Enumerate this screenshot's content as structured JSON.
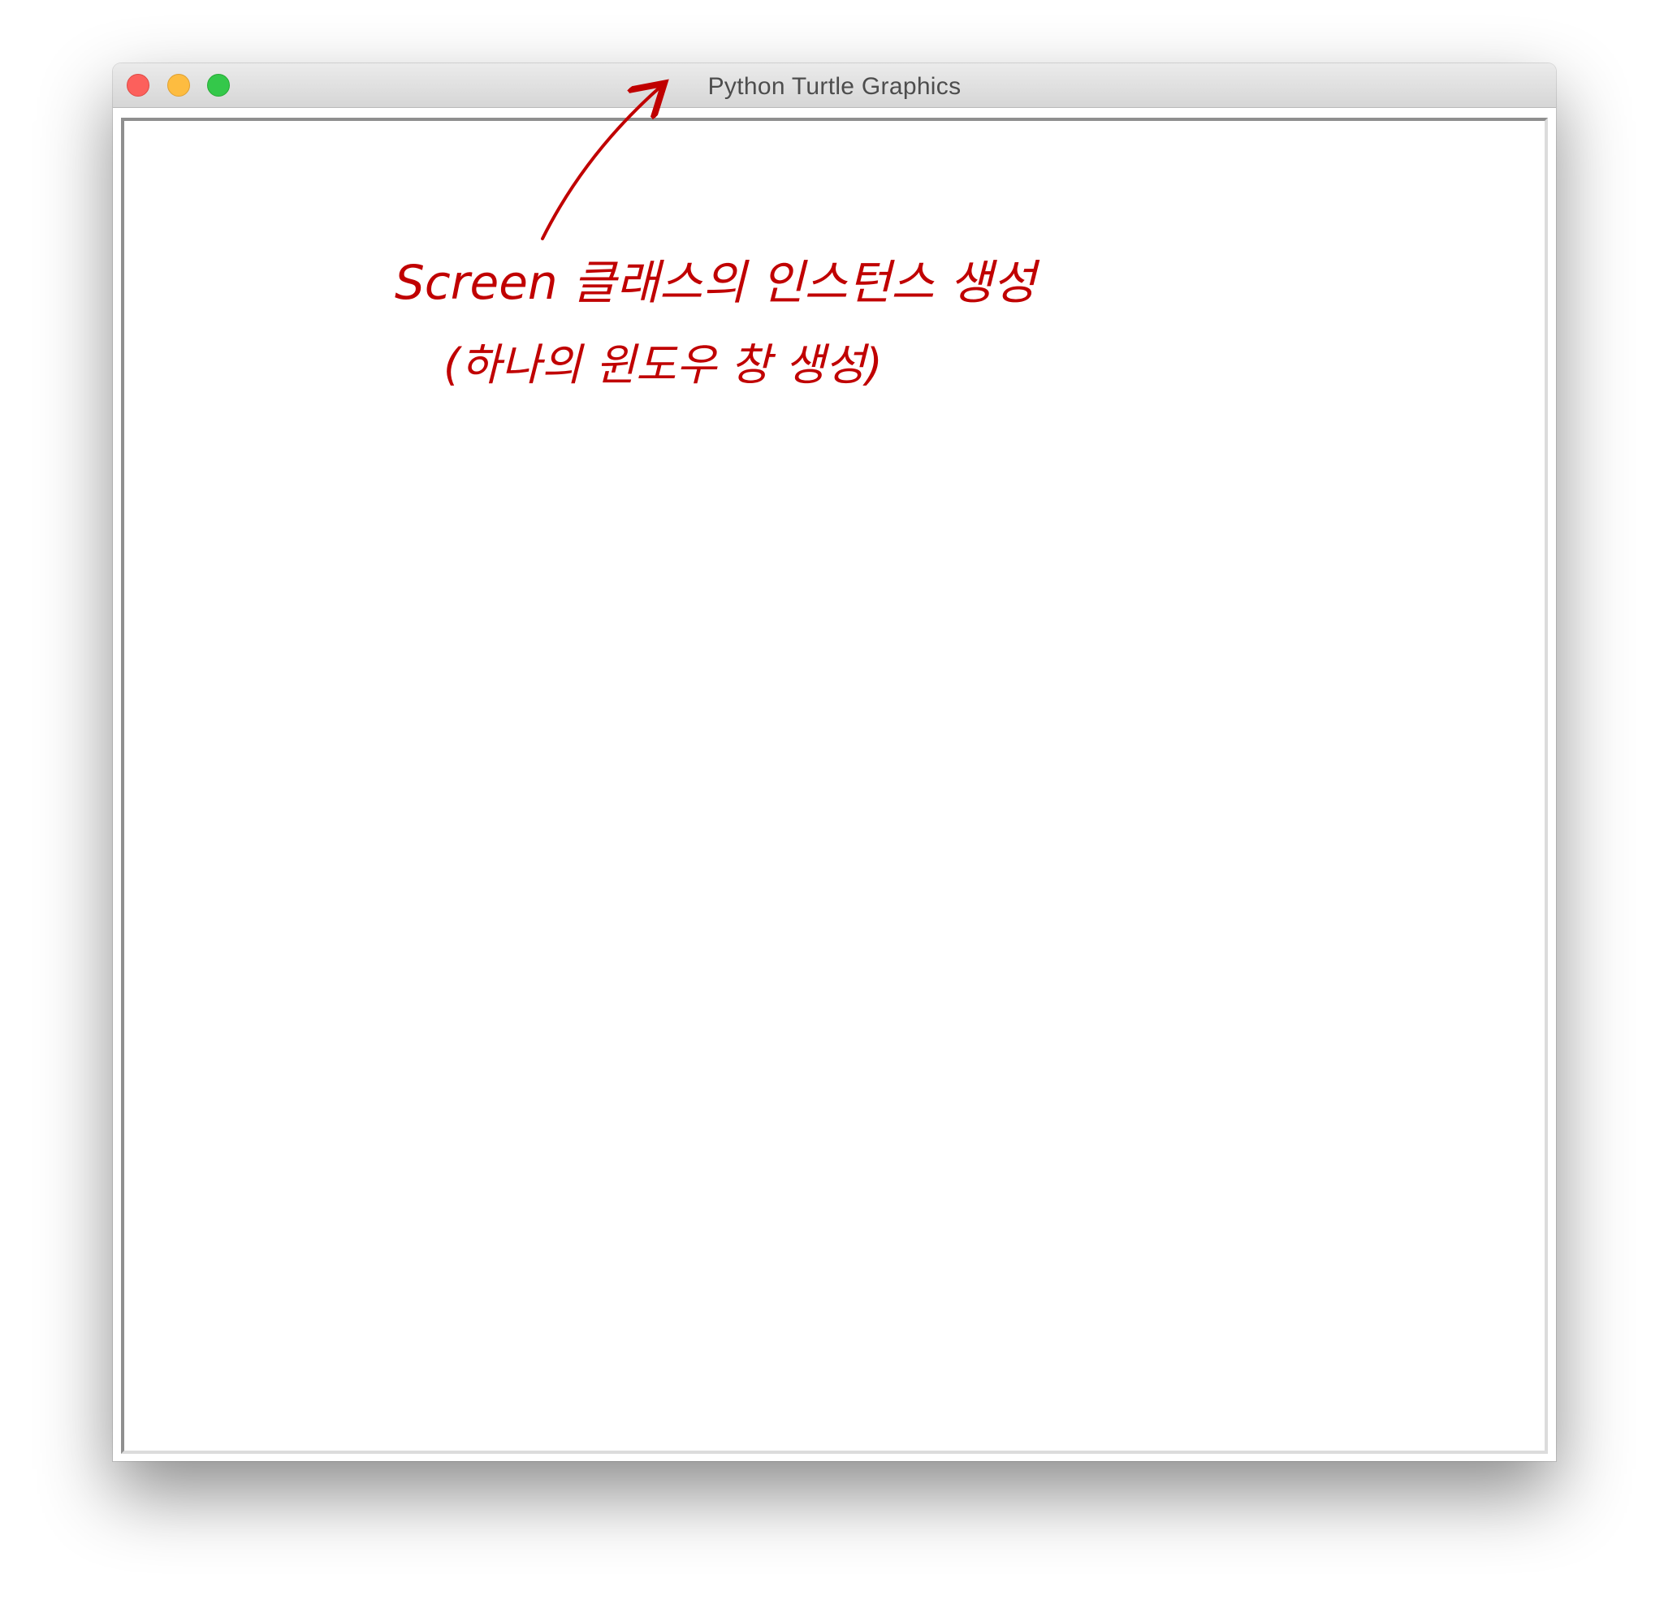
{
  "window": {
    "title": "Python Turtle Graphics",
    "buttons": {
      "close": "close-button",
      "minimize": "minimize-button",
      "zoom": "zoom-button"
    }
  },
  "annotation": {
    "color": "#c00000",
    "line1": "Screen 클래스의 인스턴스 생성",
    "line2": "(하나의 윈도우 창 생성)"
  },
  "colors": {
    "close": "#fc605c",
    "minimize": "#fdbc40",
    "zoom": "#34c84a"
  }
}
